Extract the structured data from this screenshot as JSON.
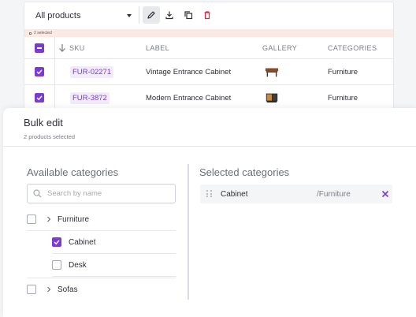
{
  "toolbar": {
    "catalog_select_value": "All products",
    "icons": [
      "edit-icon",
      "download-icon",
      "duplicate-icon",
      "delete-icon"
    ]
  },
  "selection": {
    "count_label": "2 selected"
  },
  "grid": {
    "columns": [
      "SKU",
      "LABEL",
      "GALLERY",
      "CATEGORIES"
    ],
    "rows": [
      {
        "sku": "FUR-02271",
        "label": "Vintage Entrance Cabinet",
        "category": "Furniture",
        "thumb": "cabinet-vintage"
      },
      {
        "sku": "FUR-3872",
        "label": "Modern Entrance Cabinet",
        "category": "Furniture",
        "thumb": "cabinet-modern"
      }
    ]
  },
  "bulk_edit": {
    "title": "Bulk edit",
    "subtitle": "2 products selected",
    "available": {
      "title": "Available categories",
      "search_placeholder": "Search by name",
      "tree": [
        {
          "label": "Furniture",
          "checked": false,
          "expandable": true
        },
        {
          "label": "Cabinet",
          "checked": true,
          "expandable": false
        },
        {
          "label": "Desk",
          "checked": false,
          "expandable": false
        },
        {
          "label": "Sofas",
          "checked": false,
          "expandable": true
        }
      ]
    },
    "selected": {
      "title": "Selected categories",
      "items": [
        {
          "label": "Cabinet",
          "path": "/Furniture"
        }
      ]
    }
  },
  "colors": {
    "accent": "#7c3bd0",
    "delete": "#e0273d",
    "selection_bar": "#fbe9e4"
  }
}
